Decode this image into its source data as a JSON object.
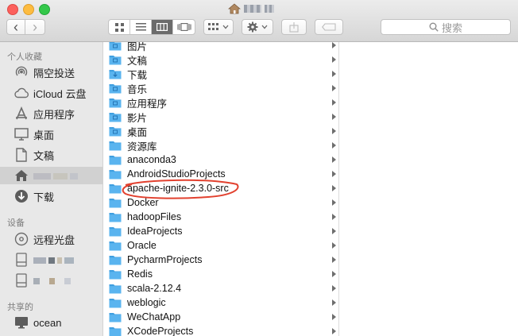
{
  "window": {
    "title_redacted": true
  },
  "toolbar": {
    "back_label": "‹",
    "forward_label": "›",
    "search_placeholder": "搜索"
  },
  "sidebar": {
    "favorites_header": "个人收藏",
    "devices_header": "设备",
    "shared_header": "共享的",
    "items": [
      {
        "label": "隔空投送",
        "icon": "airdrop-icon"
      },
      {
        "label": "iCloud 云盘",
        "icon": "cloud-icon"
      },
      {
        "label": "应用程序",
        "icon": "applications-icon"
      },
      {
        "label": "桌面",
        "icon": "desktop-icon"
      },
      {
        "label": "文稿",
        "icon": "documents-icon"
      },
      {
        "label": "",
        "icon": "home-icon",
        "selected": true
      },
      {
        "label": "下载",
        "icon": "download-icon"
      }
    ],
    "devices": [
      {
        "label": "远程光盘",
        "icon": "disc-icon"
      },
      {
        "label": "",
        "icon": "drive-icon"
      },
      {
        "label": "",
        "icon": "drive-icon"
      }
    ],
    "shared": [
      {
        "label": "ocean",
        "icon": "monitor-icon"
      }
    ]
  },
  "files": [
    {
      "name": "图片",
      "type": "special"
    },
    {
      "name": "文稿",
      "type": "special"
    },
    {
      "name": "下载",
      "type": "download"
    },
    {
      "name": "音乐",
      "type": "special"
    },
    {
      "name": "应用程序",
      "type": "special"
    },
    {
      "name": "影片",
      "type": "special"
    },
    {
      "name": "桌面",
      "type": "special"
    },
    {
      "name": "资源库",
      "type": "folder"
    },
    {
      "name": "anaconda3",
      "type": "folder"
    },
    {
      "name": "AndroidStudioProjects",
      "type": "folder"
    },
    {
      "name": "apache-ignite-2.3.0-src",
      "type": "folder",
      "annotated": true
    },
    {
      "name": "Docker",
      "type": "folder"
    },
    {
      "name": "hadoopFiles",
      "type": "folder"
    },
    {
      "name": "IdeaProjects",
      "type": "folder"
    },
    {
      "name": "Oracle",
      "type": "folder"
    },
    {
      "name": "PycharmProjects",
      "type": "folder"
    },
    {
      "name": "Redis",
      "type": "folder"
    },
    {
      "name": "scala-2.12.4",
      "type": "folder"
    },
    {
      "name": "weblogic",
      "type": "folder"
    },
    {
      "name": "WeChatApp",
      "type": "folder"
    },
    {
      "name": "XCodeProjects",
      "type": "folder"
    }
  ],
  "colors": {
    "folder": "#5ab4ef",
    "folder_tab": "#3f9fe0",
    "annotation": "#e2412f",
    "selection": "#d1d1d1"
  }
}
